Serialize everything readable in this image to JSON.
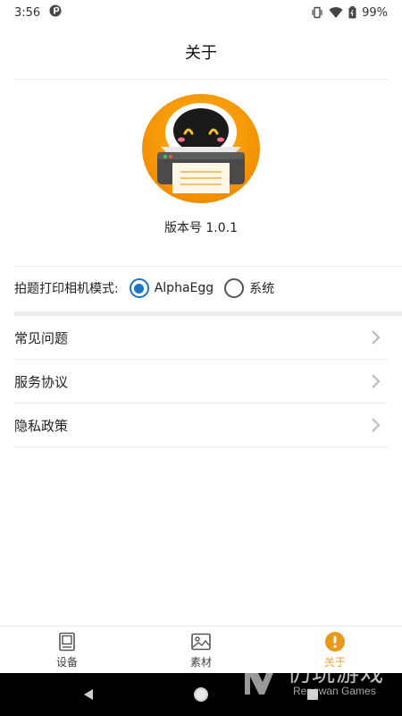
{
  "status_bar": {
    "time": "3:56",
    "battery_percent": "99%"
  },
  "header": {
    "title": "关于"
  },
  "app": {
    "version": "版本号 1.0.1"
  },
  "camera_mode": {
    "label": "拍题打印相机模式:",
    "options": [
      {
        "label": "AlphaEgg",
        "selected": true
      },
      {
        "label": "系统",
        "selected": false
      }
    ]
  },
  "menu": {
    "items": [
      {
        "label": "常见问题"
      },
      {
        "label": "服务协议"
      },
      {
        "label": "隐私政策"
      }
    ]
  },
  "bottom_nav": {
    "items": [
      {
        "label": "设备",
        "icon": "device-icon",
        "active": false
      },
      {
        "label": "素材",
        "icon": "image-icon",
        "active": false
      },
      {
        "label": "关于",
        "icon": "info-icon",
        "active": true
      }
    ]
  },
  "watermark": {
    "cn": "仍玩游戏",
    "en": "Rengwan Games"
  },
  "colors": {
    "accent": "#e8991c",
    "radio_selected": "#1e73c8",
    "divider": "#ececec"
  }
}
